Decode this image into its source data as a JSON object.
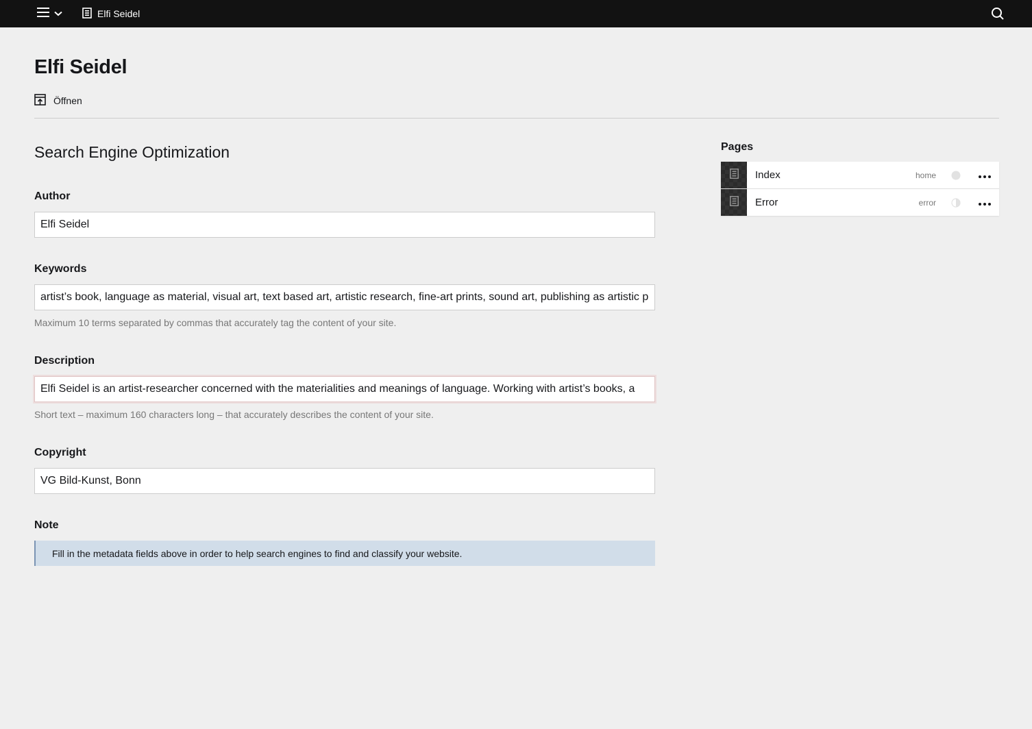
{
  "topbar": {
    "site_title": "Elfi Seidel"
  },
  "header": {
    "title": "Elfi Seidel",
    "open_label": "Öffnen"
  },
  "seo": {
    "section_title": "Search Engine Optimization",
    "author": {
      "label": "Author",
      "value": "Elfi Seidel"
    },
    "keywords": {
      "label": "Keywords",
      "value": "artist’s book, language as material, visual art, text based art, artistic research, fine-art prints, sound art, publishing as artistic practice",
      "help": "Maximum 10 terms separated by commas that accurately tag the content of your site."
    },
    "description": {
      "label": "Description",
      "value": "Elfi Seidel is an artist-researcher concerned with the materialities and meanings of language. Working with artist’s books, a",
      "help": "Short text – maximum 160 characters long – that accurately describes the content of your site."
    },
    "copyright": {
      "label": "Copyright",
      "value": "VG Bild-Kunst, Bonn"
    },
    "note": {
      "label": "Note",
      "text": "Fill in the metadata fields above in order to help search engines to find and classify your website."
    }
  },
  "pages": {
    "heading": "Pages",
    "items": [
      {
        "title": "Index",
        "template": "home",
        "status": "unlisted"
      },
      {
        "title": "Error",
        "template": "error",
        "status": "draft"
      }
    ]
  }
}
